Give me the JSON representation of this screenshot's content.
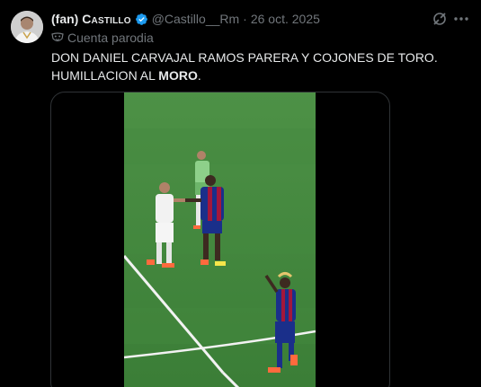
{
  "tweet": {
    "display_name_prefix": "(fan)",
    "display_name_main": "Castillo",
    "handle": "@Castillo__Rm",
    "separator": "·",
    "date": "26 oct. 2025",
    "parody_label": "Cuenta parodia",
    "text_line1": "DON DANIEL CARVAJAL RAMOS PARERA Y COJONES DE TORO.",
    "text_line2_pre": "HUMILLACION AL ",
    "text_line2_bold": "MORO",
    "text_line2_post": "."
  },
  "icons": {
    "verified": "verified-badge-icon",
    "grok": "grok-icon",
    "more": "more-horizontal-icon",
    "parody": "parody-mask-icon"
  },
  "colors": {
    "background": "#000000",
    "text_primary": "#e7e9ea",
    "text_secondary": "#71767b",
    "verified_blue": "#1d9bf0",
    "border": "#2f3336",
    "pitch_green": "#3f8a3c"
  }
}
